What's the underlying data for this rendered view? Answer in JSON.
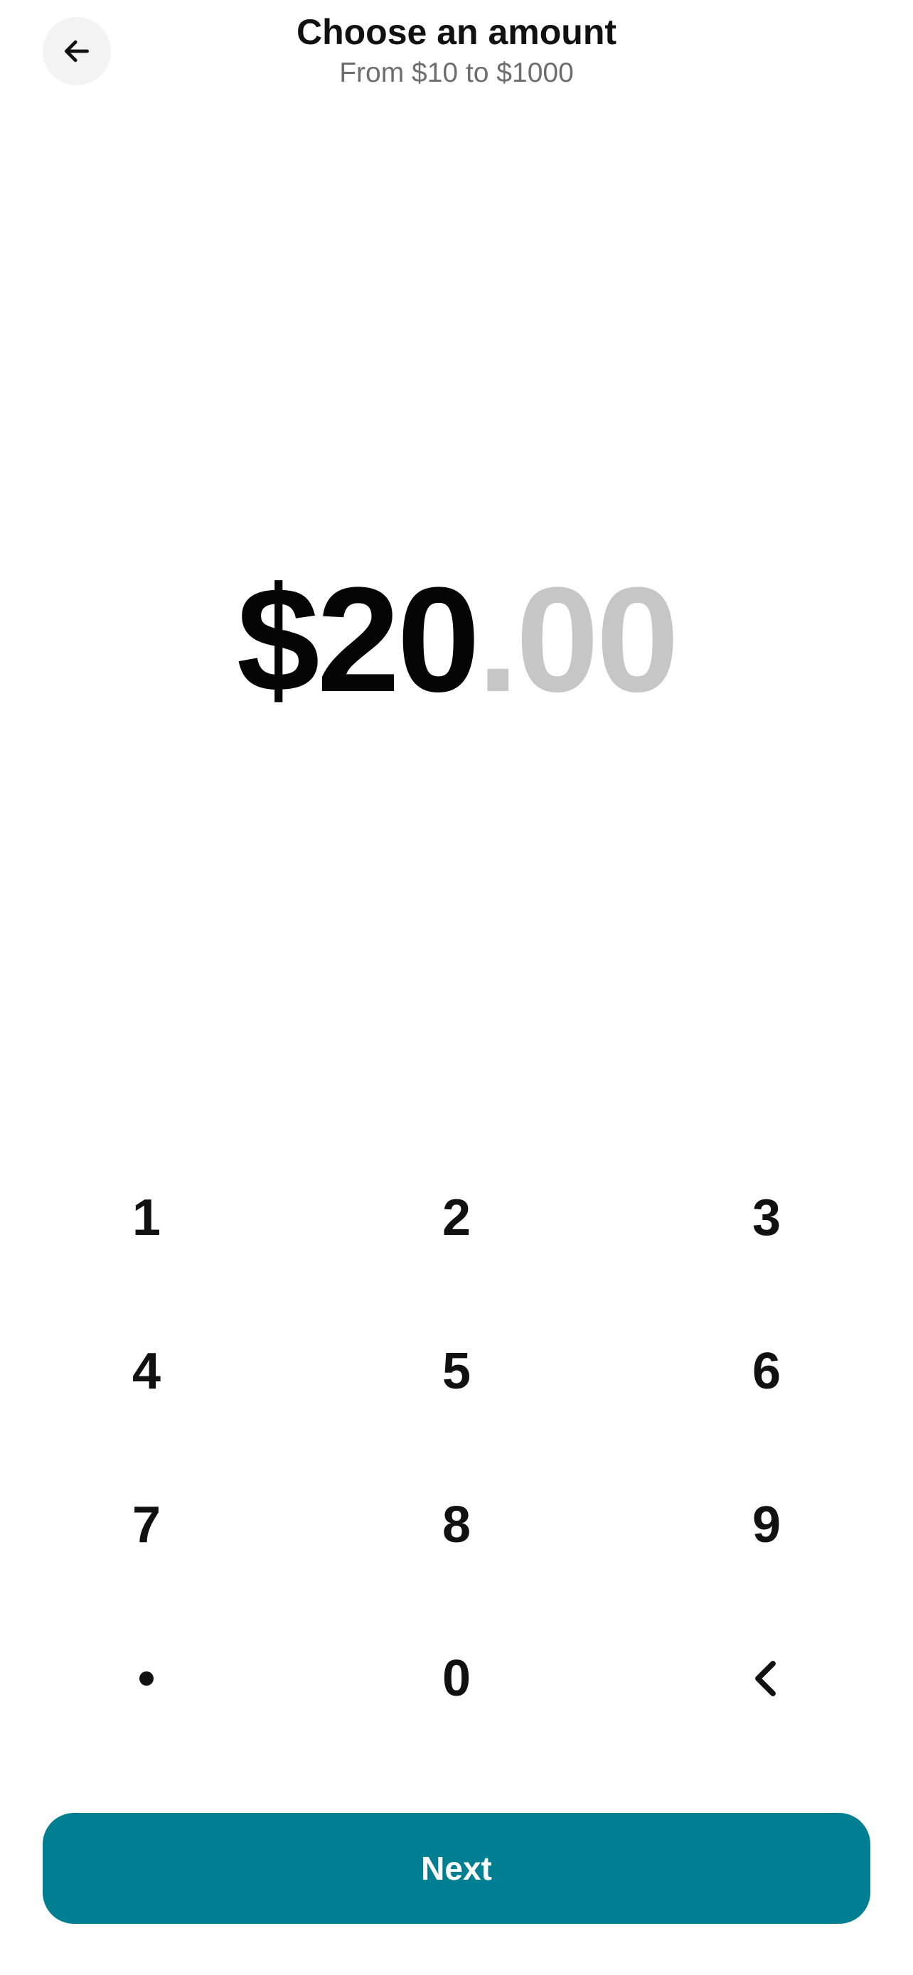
{
  "header": {
    "back_icon": "arrow-left-icon",
    "title": "Choose an amount",
    "subtitle": "From $10 to $1000"
  },
  "amount": {
    "whole": "$20",
    "decimal_point": ".",
    "cents": "00"
  },
  "keypad": {
    "keys": [
      {
        "label": "1",
        "name": "key-1"
      },
      {
        "label": "2",
        "name": "key-2"
      },
      {
        "label": "3",
        "name": "key-3"
      },
      {
        "label": "4",
        "name": "key-4"
      },
      {
        "label": "5",
        "name": "key-5"
      },
      {
        "label": "6",
        "name": "key-6"
      },
      {
        "label": "7",
        "name": "key-7"
      },
      {
        "label": "8",
        "name": "key-8"
      },
      {
        "label": "9",
        "name": "key-9"
      },
      {
        "label": "0",
        "name": "key-0"
      }
    ],
    "decimal_key_icon": "dot-icon",
    "backspace_key_icon": "chevron-left-icon"
  },
  "footer": {
    "next_label": "Next"
  },
  "colors": {
    "accent": "#007f93",
    "amount_primary": "#050505",
    "amount_placeholder": "#c6c6c6",
    "subtitle": "#6e6e6e"
  }
}
